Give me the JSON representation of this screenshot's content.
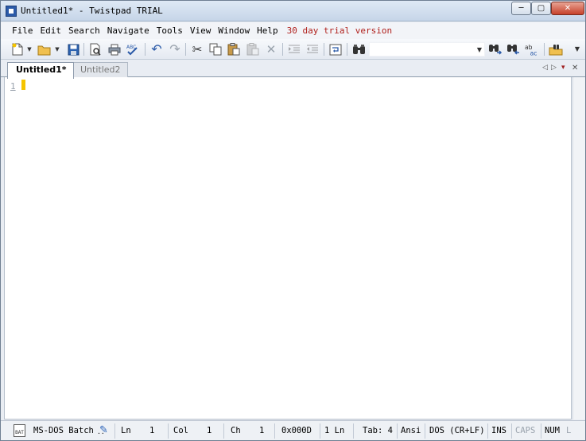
{
  "window": {
    "title": "Untitled1* - Twistpad TRIAL"
  },
  "title_buttons": {
    "minimize": "─",
    "maximize": "▢",
    "close": "✕"
  },
  "menu": {
    "items": [
      "File",
      "Edit",
      "Search",
      "Navigate",
      "Tools",
      "View",
      "Window",
      "Help"
    ],
    "trial_notice": "30 day trial version"
  },
  "toolbar": {
    "icons": [
      "new-file-icon",
      "open-folder-icon",
      "save-icon",
      "print-preview-icon",
      "print-icon",
      "spellcheck-icon",
      "undo-icon",
      "redo-icon",
      "cut-icon",
      "copy-icon",
      "paste-icon",
      "paste-special-icon",
      "delete-icon",
      "indent-icon",
      "unindent-icon",
      "word-wrap-icon",
      "find-icon",
      "find-next-icon",
      "find-previous-icon",
      "replace-icon",
      "find-in-files-icon"
    ],
    "search_value": ""
  },
  "tabs": [
    {
      "label": "Untitled1*",
      "active": true
    },
    {
      "label": "Untitled2",
      "active": false
    }
  ],
  "editor": {
    "line_numbers": [
      "1"
    ],
    "content": ""
  },
  "statusbar": {
    "file_type": "MS-DOS Batch",
    "ln_label": "Ln",
    "ln_value": "1",
    "col_label": "Col",
    "col_value": "1",
    "ch_label": "Ch",
    "ch_value": "1",
    "char_code": "0x000D",
    "lines": "1 Ln",
    "tab": "Tab: 4",
    "encoding": "Ansi",
    "line_endings": "DOS (CR+LF)",
    "ins": "INS",
    "caps": "CAPS",
    "num": "NUM",
    "last": "L"
  },
  "colors": {
    "trial_notice": "#b0201c",
    "caret": "#f5c400",
    "title_bar": "#c6d5e8"
  }
}
